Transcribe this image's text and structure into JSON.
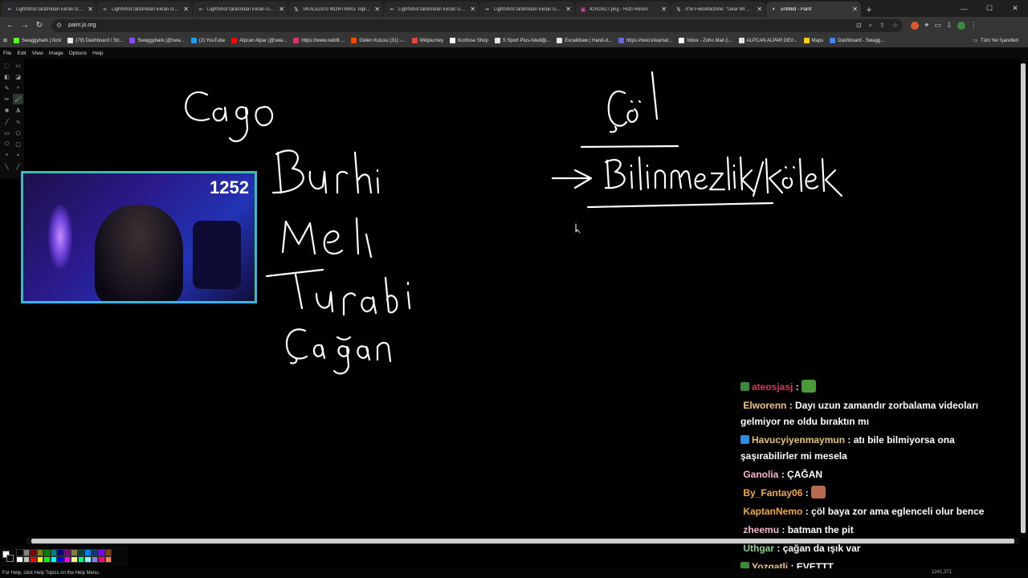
{
  "tabs": [
    {
      "label": "LightShot tarafından Ekran Görüntüsü",
      "icon": "feather-icon",
      "active": false
    },
    {
      "label": "LightShot tarafından Ekran Görüntüsü",
      "icon": "feather-icon",
      "active": false
    },
    {
      "label": "LightShot tarafından Ekran Görüntüsü",
      "icon": "feather-icon",
      "active": false
    },
    {
      "label": "SKALEDUS MORTIMAS Topluluk",
      "icon": "x-icon",
      "active": false
    },
    {
      "label": "LightShot tarafından Ekran Görüntüsü",
      "icon": "feather-icon",
      "active": false
    },
    {
      "label": "LightShot tarafından Ekran Görüntüsü",
      "icon": "feather-icon",
      "active": false
    },
    {
      "label": "42m2627.png - Hızlı Resim",
      "icon": "image-icon",
      "active": false
    },
    {
      "label": "X'te FeksMachine: \"Dear Mr Alp...",
      "icon": "x-icon",
      "active": false
    },
    {
      "label": "untitled - Paint",
      "icon": "paint-icon",
      "active": true
    }
  ],
  "address": {
    "url": "paint.js.org"
  },
  "bookmarks": [
    "Swaggybark | Kick",
    "(79) Dashboard / Str...",
    "Swaggybark (@swa...",
    "(2) YouTube",
    "Alpcan Alpar (@swa...",
    "https://www.reddit....",
    "Gelen Kutusu (31) -...",
    "Midjourney",
    "Konfuse Shop",
    "S Sport Plus-İstediği...",
    "Excalidraw | Hand-d...",
    "https://next.inkarnat...",
    "Inbox - Zoho Mail (i...",
    "ALPCAN ALPAR DEV...",
    "Maps",
    "Dashboard - Swagg..."
  ],
  "bookmarks_all": "Tüm Yer İşaretleri",
  "paint": {
    "menu": [
      "File",
      "Edit",
      "View",
      "Image",
      "Options",
      "Help"
    ],
    "status": "For Help, click Help Topics on the Help Menu.",
    "coords": "1241,371",
    "palette": [
      "#000000",
      "#808080",
      "#800000",
      "#808000",
      "#008000",
      "#008080",
      "#000080",
      "#800080",
      "#808040",
      "#004040",
      "#0080ff",
      "#004080",
      "#8000ff",
      "#804000",
      "#ffffff",
      "#c0c0c0",
      "#ff0000",
      "#ffff00",
      "#00ff00",
      "#00ffff",
      "#0000ff",
      "#ff00ff",
      "#ffff80",
      "#00ff80",
      "#80ffff",
      "#8080ff",
      "#ff0080",
      "#ff8040"
    ]
  },
  "webcam": {
    "counter": "1252"
  },
  "chat": [
    {
      "user": "ateosjasj",
      "color": "#e0325c",
      "badge": "#3a8a3a",
      "message": "",
      "emote": "#4a9a3a"
    },
    {
      "user": "Elworenn",
      "color": "#f2c57a",
      "message": "Dayı uzun zamandır zorbalama videoları gelmiyor ne oldu bıraktın mı"
    },
    {
      "user": "Havucyiyenmaymun",
      "color": "#e8c070",
      "badge": "#2b8de0",
      "message": "atı bile bilmiyorsa ona şaşırabilirler mi mesela"
    },
    {
      "user": "Ganolia",
      "color": "#f5b8c8",
      "message": "ÇAĞAN"
    },
    {
      "user": "By_Fantay06",
      "color": "#f2a93b",
      "message": "",
      "emote": "#b86a50"
    },
    {
      "user": "KaptanNemo",
      "color": "#f2a93b",
      "message": "çöl baya zor ama eglenceli olur bence"
    },
    {
      "user": "zheemu",
      "color": "#f5b8c8",
      "message": "batman the pit"
    },
    {
      "user": "Uthgar",
      "color": "#8fd28f",
      "message": "çağan da ışık var"
    },
    {
      "user": "Yozgatli",
      "color": "#f2c57a",
      "badge": "#3a8a3a",
      "message": "EVETTT"
    }
  ]
}
